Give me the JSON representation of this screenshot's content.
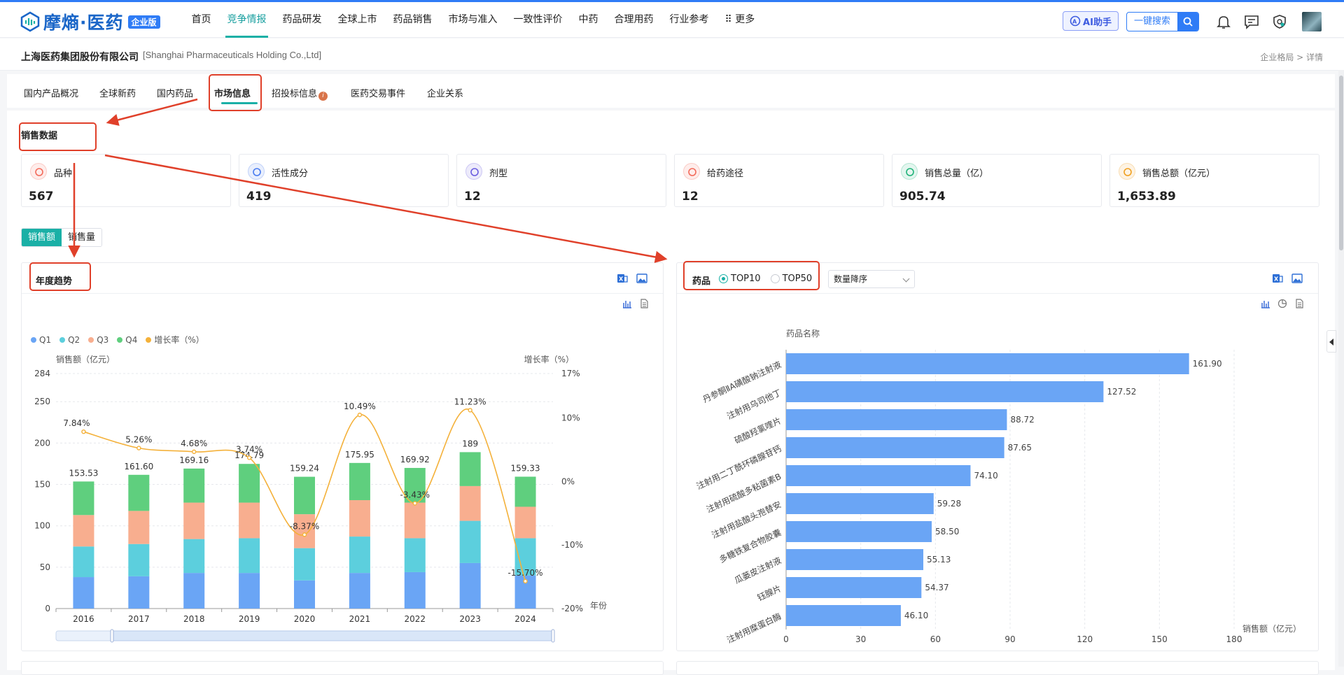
{
  "header": {
    "logo_text": "摩熵·医药",
    "logo_badge": "企业版",
    "nav": [
      "首页",
      "竞争情报",
      "药品研发",
      "全球上市",
      "药品销售",
      "市场与准入",
      "一致性评价",
      "中药",
      "合理用药",
      "行业参考",
      "⠿ 更多"
    ],
    "active_nav_index": 1,
    "ai_button": "AI助手",
    "search_button": "一键搜索",
    "icons": [
      "bell-icon",
      "message-icon",
      "shield-icon",
      "avatar"
    ]
  },
  "company": {
    "name": "上海医药集团股份有限公司",
    "name_en": "[Shanghai Pharmaceuticals Holding Co.,Ltd]",
    "breadcrumb": "企业格局 > 详情"
  },
  "tabs": {
    "items": [
      "国内产品概况",
      "全球新药",
      "国内药品",
      "市场信息",
      "招投标信息",
      "医药交易事件",
      "企业关系"
    ],
    "active": "市场信息",
    "info_mark": "i"
  },
  "sales": {
    "title": "销售数据",
    "stats": [
      {
        "label": "品种",
        "value": "567",
        "color": "#f36b5b"
      },
      {
        "label": "活性成分",
        "value": "419",
        "color": "#4a7cf0"
      },
      {
        "label": "剂型",
        "value": "12",
        "color": "#6b5de0"
      },
      {
        "label": "给药途径",
        "value": "12",
        "color": "#f36b5b"
      },
      {
        "label": "销售总量（亿）",
        "value": "905.74",
        "color": "#21b37a"
      },
      {
        "label": "销售总额（亿元）",
        "value": "1,653.89",
        "color": "#f0a020"
      }
    ],
    "toggle": [
      "销售额",
      "销售量"
    ],
    "toggle_active": "销售额"
  },
  "trend_panel": {
    "title": "年度趋势",
    "icons": [
      "excel-export-icon",
      "image-export-icon",
      "bar-chart-icon",
      "data-view-icon"
    ]
  },
  "top_panel": {
    "label": "药品",
    "radio": [
      "TOP10",
      "TOP50"
    ],
    "radio_selected": "TOP10",
    "sort": "数量降序",
    "icons": [
      "excel-export-icon",
      "image-export-icon",
      "bar-chart-icon",
      "pie-chart-icon",
      "data-view-icon"
    ]
  },
  "chart_data": [
    {
      "type": "bar",
      "stacked": true,
      "categories": [
        "2016",
        "2017",
        "2018",
        "2019",
        "2020",
        "2021",
        "2022",
        "2023",
        "2024"
      ],
      "series": [
        {
          "name": "Q1",
          "color": "#6aa5f5",
          "values": [
            38,
            39,
            43,
            43,
            34,
            43,
            44,
            55,
            40
          ]
        },
        {
          "name": "Q2",
          "color": "#5ccfdd",
          "values": [
            37,
            39,
            41,
            42,
            39,
            44,
            41,
            51,
            45
          ]
        },
        {
          "name": "Q3",
          "color": "#f8ae8f",
          "values": [
            38,
            40,
            44,
            43,
            41,
            44,
            43,
            42,
            38
          ]
        },
        {
          "name": "Q4",
          "color": "#5fcf7e",
          "values": [
            40.53,
            43.6,
            41.16,
            46.79,
            45.24,
            44.95,
            41.92,
            41,
            36.33
          ]
        }
      ],
      "totals": [
        "153.53",
        "161.60",
        "169.16",
        "174.79",
        "159.24",
        "175.95",
        "169.92",
        "189",
        "159.33"
      ],
      "line": {
        "name": "增长率（%）",
        "color": "#f4b13a",
        "values": [
          7.84,
          5.26,
          4.68,
          3.74,
          -8.37,
          10.49,
          -3.43,
          11.23,
          -15.7
        ],
        "labels": [
          "7.84%",
          "5.26%",
          "4.68%",
          "3.74%",
          "-8.37%",
          "10.49%",
          "-3.43%",
          "11.23%",
          "-15.70%"
        ]
      },
      "ylabel": "销售额（亿元）",
      "y2label": "增长率（%）",
      "xlabel": "年份",
      "ylim": [
        0,
        284
      ],
      "yticks": [
        0,
        50,
        100,
        150,
        200,
        250,
        284
      ],
      "y2lim": [
        -20,
        17
      ],
      "y2ticks": [
        "17%",
        "10%",
        "0%",
        "-10%",
        "-20%"
      ],
      "legend": "top-left",
      "grid": true
    },
    {
      "type": "bar",
      "orientation": "horizontal",
      "categories": [
        "丹参酮ⅡA磺酸钠注射液",
        "注射用乌司他丁",
        "硫酸羟氯喹片",
        "注射用二丁酰环磷腺苷钙",
        "注射用硫酸多粘菌素B",
        "注射用盐酸头孢替安",
        "多糖铁复合物胶囊",
        "瓜蒌皮注射液",
        "钰腺片",
        "注射用糜蛋白酶"
      ],
      "values": [
        161.9,
        127.52,
        88.72,
        87.65,
        74.1,
        59.28,
        58.5,
        55.13,
        54.37,
        46.1
      ],
      "value_labels": [
        "161.90",
        "127.52",
        "88.72",
        "87.65",
        "74.10",
        "59.28",
        "58.50",
        "55.13",
        "54.37",
        "46.10"
      ],
      "color": "#6aa5f5",
      "ylabel": "药品名称",
      "xlabel": "销售额（亿元）",
      "xlim": [
        0,
        180
      ],
      "xticks": [
        0,
        30,
        60,
        90,
        120,
        150,
        180
      ],
      "grid": true
    }
  ]
}
